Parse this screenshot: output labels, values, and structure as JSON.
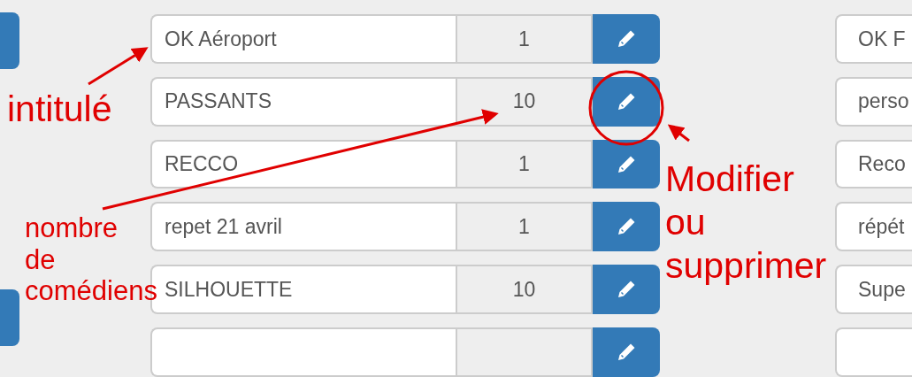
{
  "left_buttons": [
    {
      "kind": "edge-button"
    },
    {
      "kind": "edge-button"
    }
  ],
  "rows": [
    {
      "kind": "row",
      "label": "OK Aéroport",
      "count": "1"
    },
    {
      "kind": "row",
      "label": "PASSANTS",
      "count": "10"
    },
    {
      "kind": "row",
      "label": "RECCO",
      "count": "1"
    },
    {
      "kind": "row",
      "label": "repet 21 avril",
      "count": "1"
    },
    {
      "kind": "row",
      "label": "SILHOUETTE",
      "count": "10"
    },
    {
      "kind": "cut-off"
    }
  ],
  "right_fields": [
    {
      "kind": "field",
      "label": "OK F"
    },
    {
      "kind": "field",
      "label": "perso"
    },
    {
      "kind": "field",
      "label": "Reco"
    },
    {
      "kind": "field",
      "label": "répét"
    },
    {
      "kind": "field",
      "label": "Supe"
    },
    {
      "kind": "cut-off"
    }
  ],
  "annotations": [
    {
      "kind": "label-note",
      "text": "intitulé"
    },
    {
      "kind": "count-note",
      "text": "nombre\nde\ncomédiens"
    },
    {
      "kind": "button-note",
      "text": "Modifier\nou\nsupprimer"
    }
  ]
}
